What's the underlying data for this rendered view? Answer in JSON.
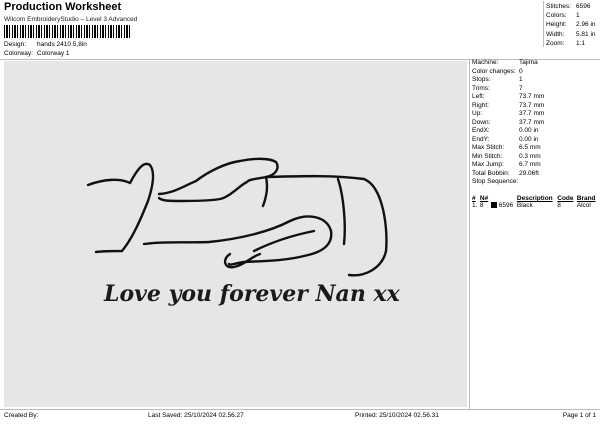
{
  "header": {
    "title": "Production Worksheet",
    "subtitle": "Wilcom EmbroideryStudio – Level 3 Advanced",
    "design_label": "Design:",
    "design_value": "hands 2410 5,8in",
    "colorway_label": "Colorway:",
    "colorway_value": "Colorway 1"
  },
  "stats": [
    {
      "label": "Stitches:",
      "value": "6596"
    },
    {
      "label": "Colors:",
      "value": "1"
    },
    {
      "label": "Height:",
      "value": "2.96 in"
    },
    {
      "label": "Width:",
      "value": "5.81 in"
    },
    {
      "label": "Zoom:",
      "value": "1:1"
    }
  ],
  "specs": [
    {
      "label": "Machine:",
      "value": "Tajima"
    },
    {
      "label": "Color changes:",
      "value": "0"
    },
    {
      "label": "Stops:",
      "value": "1"
    },
    {
      "label": "Trims:",
      "value": "7"
    },
    {
      "label": "Left:",
      "value": "73.7 mm"
    },
    {
      "label": "Right:",
      "value": "73.7 mm"
    },
    {
      "label": "Up:",
      "value": "37.7 mm"
    },
    {
      "label": "Down:",
      "value": "37.7 mm"
    },
    {
      "label": "EndX:",
      "value": "0.00 in"
    },
    {
      "label": "EndY:",
      "value": "0.00 in"
    },
    {
      "label": "Max Stitch:",
      "value": "6.5 mm"
    },
    {
      "label": "Min Stitch:",
      "value": "0.3 mm"
    },
    {
      "label": "Max Jump:",
      "value": "6.7 mm"
    },
    {
      "label": "Total Bobbin:",
      "value": "29.06ft"
    },
    {
      "label": "Stop Sequence:",
      "value": ""
    }
  ],
  "sequence": {
    "headers": [
      "#",
      "N#",
      "",
      "Description",
      "Code",
      "Brand"
    ],
    "rows": [
      {
        "num": "1.",
        "n": "8",
        "stitches": "6596",
        "description": "Black",
        "code": "8",
        "brand": "Alcol",
        "color": "#000000"
      }
    ]
  },
  "design_text": "Love you forever Nan xx",
  "footer": {
    "created_label": "Created By:",
    "created_value": "",
    "saved": "Last Saved: 25/10/2024 02.56.27",
    "printed": "Printed: 25/10/2024 02.56.31",
    "page": "Page 1 of 1"
  }
}
